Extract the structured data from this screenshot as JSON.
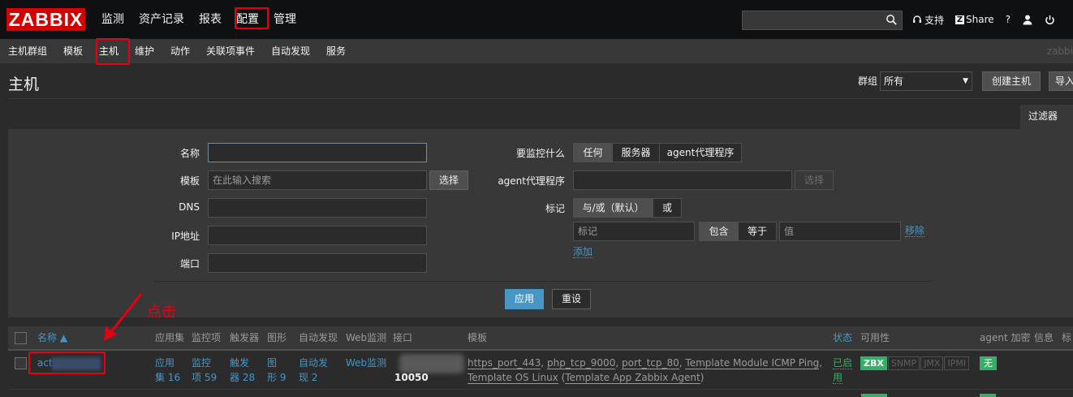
{
  "app": {
    "logo": "ZABBIX"
  },
  "main_menu": [
    "监测",
    "资产记录",
    "报表",
    "配置",
    "管理"
  ],
  "search": {
    "value": ""
  },
  "top_right": {
    "support": "支持",
    "share": "Share",
    "help": "?"
  },
  "sub_menu": [
    "主机群组",
    "模板",
    "主机",
    "维护",
    "动作",
    "关联项事件",
    "自动发现",
    "服务"
  ],
  "sub_right": "zabbi",
  "header": {
    "title": "主机",
    "group_label": "群组",
    "group_value": "所有",
    "create_button": "创建主机",
    "import_button": "导入"
  },
  "filter": {
    "tab_label": "过滤器",
    "name_label": "名称",
    "template_label": "模板",
    "template_placeholder": "在此输入搜索",
    "select_button": "选择",
    "dns_label": "DNS",
    "ip_label": "IP地址",
    "port_label": "端口",
    "monitor_label": "要监控什么",
    "monitor_options": [
      "任何",
      "服务器",
      "agent代理程序"
    ],
    "proxy_label": "agent代理程序",
    "proxy_select": "选择",
    "tags_label": "标记",
    "tags_mode": [
      "与/或（默认）",
      "或"
    ],
    "tag_placeholder": "标记",
    "tag_ops": [
      "包含",
      "等于"
    ],
    "value_placeholder": "值",
    "remove_link": "移除",
    "add_link": "添加",
    "apply_button": "应用",
    "reset_button": "重设"
  },
  "table": {
    "headers": {
      "name": "名称 ▲",
      "apps": "应用集",
      "items": "监控项",
      "triggers": "触发器",
      "graphs": "图形",
      "discovery": "自动发现",
      "web": "Web监测",
      "interface": "接口",
      "templates": "模板",
      "status": "状态",
      "availability": "可用性",
      "encryption": "agent 加密",
      "info": "信息",
      "tags": "标"
    },
    "row": {
      "name": "acti",
      "apps": [
        "应用",
        "集 16"
      ],
      "items": [
        "监控",
        "项 59"
      ],
      "triggers": [
        "触发",
        "器 28"
      ],
      "graphs": [
        "图",
        "形 9"
      ],
      "discovery": [
        "自动发",
        "现 2"
      ],
      "web": "Web监测",
      "port": "10050",
      "templates_line1": [
        "https_port_443",
        "php_tcp_9000",
        "port_tcp_80",
        "Template Module ICMP Ping"
      ],
      "templates_line2": "Template OS Linux",
      "templates_line2_paren": "Template App Zabbix Agent",
      "status": [
        "已启",
        "用"
      ],
      "availability": [
        "ZBX",
        "SNMP",
        "JMX",
        "IPMI"
      ],
      "encryption": "无"
    }
  },
  "annotation": {
    "note": "点击",
    "color": "#e60012"
  }
}
